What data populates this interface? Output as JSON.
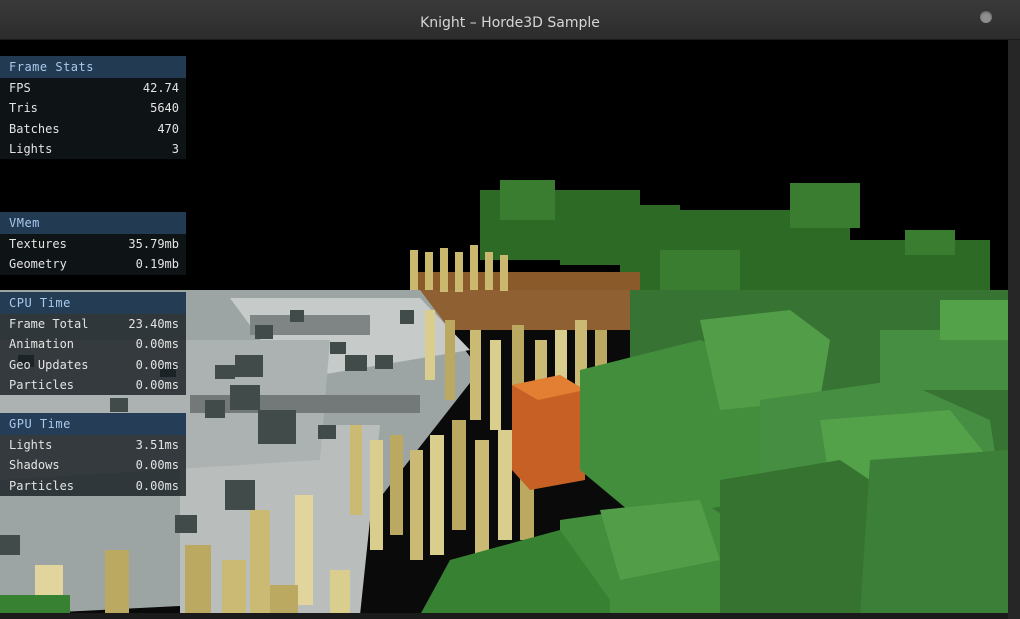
{
  "window": {
    "title": "Knight – Horde3D Sample"
  },
  "overlay": {
    "frame_stats": {
      "title": "Frame Stats",
      "rows": [
        {
          "label": "FPS",
          "value": "42.74"
        },
        {
          "label": "Tris",
          "value": "5640"
        },
        {
          "label": "Batches",
          "value": "470"
        },
        {
          "label": "Lights",
          "value": "3"
        }
      ]
    },
    "vmem": {
      "title": "VMem",
      "rows": [
        {
          "label": "Textures",
          "value": "35.79mb"
        },
        {
          "label": "Geometry",
          "value": "0.19mb"
        }
      ]
    },
    "cpu_time": {
      "title": "CPU Time",
      "rows": [
        {
          "label": "Frame Total",
          "value": "23.40ms"
        },
        {
          "label": "Animation",
          "value": "0.00ms"
        },
        {
          "label": "Geo Updates",
          "value": "0.00ms"
        },
        {
          "label": "Particles",
          "value": "0.00ms"
        }
      ]
    },
    "gpu_time": {
      "title": "GPU Time",
      "rows": [
        {
          "label": "Lights",
          "value": "3.51ms"
        },
        {
          "label": "Shadows",
          "value": "0.00ms"
        },
        {
          "label": "Particles",
          "value": "0.00ms"
        }
      ]
    }
  },
  "colors": {
    "panel_header_text": "#a9c9ec",
    "panel_header_bg": "#243e58",
    "ground_gray": "#9ea5a4",
    "pillar_yellow": "#c9b86e",
    "foliage_green": "#3f8a3a",
    "crate_orange": "#c45a1c"
  }
}
